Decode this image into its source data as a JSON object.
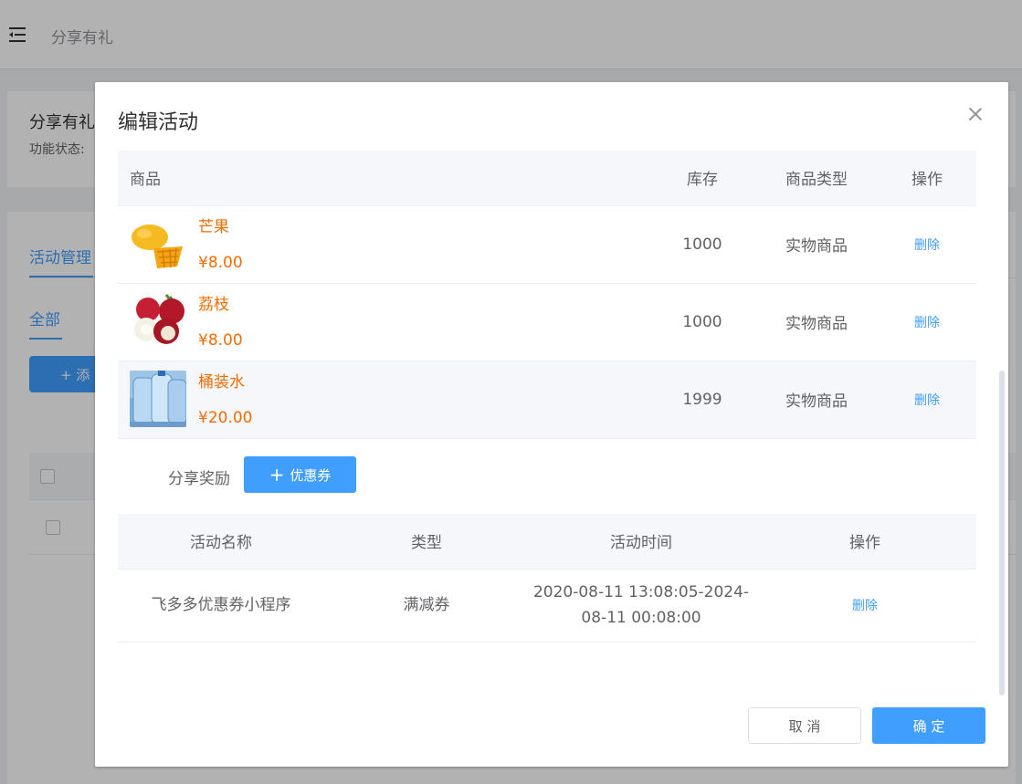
{
  "background": {
    "breadcrumb": "分享有礼",
    "card_title": "分享有礼",
    "card_status": "功能状态:",
    "tab_active": "活动管理",
    "subtab_active": "全部",
    "add_button": "+ 添"
  },
  "dialog": {
    "title": "编辑活动",
    "goods_table": {
      "headers": [
        "商品",
        "库存",
        "商品类型",
        "操作"
      ],
      "rows": [
        {
          "name": "芒果",
          "price": "¥8.00",
          "stock": "1000",
          "type": "实物商品",
          "action": "删除",
          "thumb_icon": "mango-image"
        },
        {
          "name": "荔枝",
          "price": "¥8.00",
          "stock": "1000",
          "type": "实物商品",
          "action": "删除",
          "thumb_icon": "lychee-image"
        },
        {
          "name": "桶装水",
          "price": "¥20.00",
          "stock": "1999",
          "type": "实物商品",
          "action": "删除",
          "thumb_icon": "water-bottle-image"
        }
      ]
    },
    "reward": {
      "label": "分享奖励",
      "button_icon": "plus-icon",
      "button": "优惠券"
    },
    "coupon_table": {
      "headers": [
        "活动名称",
        "类型",
        "活动时间",
        "操作"
      ],
      "rows": [
        {
          "name": "飞多多优惠券小程序",
          "type": "满减券",
          "time_line1": "2020-08-11 13:08:05-2024-",
          "time_line2": "08-11 00:08:00",
          "action": "删除"
        }
      ]
    },
    "cancel": "取 消",
    "confirm": "确 定"
  },
  "colors": {
    "primary": "#409eff",
    "price": "#f56c00",
    "header_bg": "#f5f7fa"
  }
}
